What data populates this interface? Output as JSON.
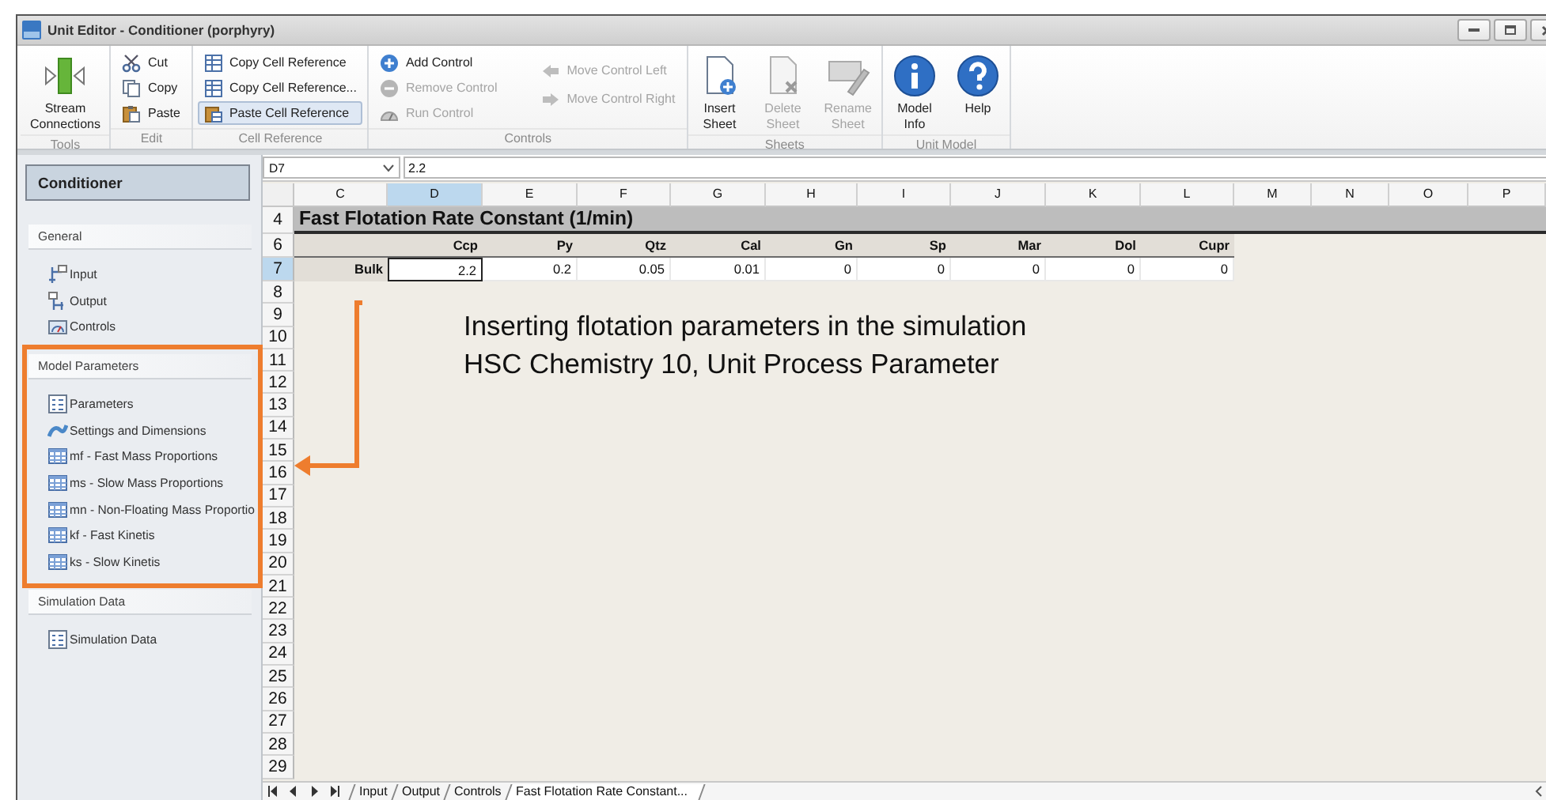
{
  "window": {
    "title": "Unit Editor - Conditioner (porphyry)"
  },
  "ribbon": {
    "groups": [
      {
        "label": "Tools",
        "columns": [
          [
            {
              "label": "Stream\nConnections",
              "kind": "large",
              "disabled": false,
              "highlighted": false
            }
          ]
        ]
      },
      {
        "label": "Edit",
        "columns": [
          [
            {
              "label": "Cut",
              "kind": "small",
              "disabled": false,
              "highlighted": false
            },
            {
              "label": "Copy",
              "kind": "small",
              "disabled": false,
              "highlighted": false
            },
            {
              "label": "Paste",
              "kind": "small",
              "disabled": false,
              "highlighted": false
            }
          ]
        ]
      },
      {
        "label": "Cell Reference",
        "columns": [
          [
            {
              "label": "Copy Cell Reference",
              "kind": "small",
              "disabled": false,
              "highlighted": false
            },
            {
              "label": "Copy Cell Reference...",
              "kind": "small",
              "disabled": false,
              "highlighted": false
            },
            {
              "label": "Paste Cell Reference",
              "kind": "small",
              "disabled": false,
              "highlighted": true
            }
          ]
        ]
      },
      {
        "label": "Controls",
        "columns": [
          [
            {
              "label": "Add Control",
              "kind": "small",
              "disabled": false,
              "highlighted": false
            },
            {
              "label": "Remove Control",
              "kind": "small",
              "disabled": true,
              "highlighted": false
            },
            {
              "label": "Run Control",
              "kind": "small",
              "disabled": true,
              "highlighted": false
            }
          ],
          [
            {
              "label": "Move Control Left",
              "kind": "small",
              "disabled": true,
              "highlighted": false
            },
            {
              "label": "Move Control Right",
              "kind": "small",
              "disabled": true,
              "highlighted": false
            }
          ]
        ]
      },
      {
        "label": "Sheets",
        "columns": [
          [
            {
              "label": "Insert\nSheet",
              "kind": "large",
              "disabled": false,
              "highlighted": false
            }
          ],
          [
            {
              "label": "Delete\nSheet",
              "kind": "large",
              "disabled": true,
              "highlighted": false
            }
          ],
          [
            {
              "label": "Rename\nSheet",
              "kind": "large",
              "disabled": true,
              "highlighted": false
            }
          ]
        ]
      },
      {
        "label": "Unit Model",
        "columns": [
          [
            {
              "label": "Model\nInfo",
              "kind": "large",
              "disabled": false,
              "highlighted": false
            }
          ],
          [
            {
              "label": "Help",
              "kind": "large",
              "disabled": false,
              "highlighted": false
            }
          ]
        ]
      }
    ]
  },
  "sidebar": {
    "header": "Conditioner",
    "sections": [
      {
        "title": "General",
        "items": [
          {
            "label": "Input"
          },
          {
            "label": "Output"
          },
          {
            "label": "Controls"
          }
        ]
      },
      {
        "title": "Model Parameters",
        "items": [
          {
            "label": "Parameters"
          },
          {
            "label": "Settings and Dimensions"
          },
          {
            "label": "mf - Fast Mass Proportions"
          },
          {
            "label": "ms - Slow Mass Proportions"
          },
          {
            "label": "mn - Non-Floating Mass Proportio"
          },
          {
            "label": "kf - Fast Kinetis"
          },
          {
            "label": "ks - Slow Kinetis"
          }
        ]
      },
      {
        "title": "Simulation Data",
        "items": [
          {
            "label": "Simulation Data"
          }
        ]
      }
    ]
  },
  "sheet": {
    "name_box": "D7",
    "formula": "2.2",
    "columns": [
      {
        "label": "C",
        "selected": false
      },
      {
        "label": "D",
        "selected": true
      },
      {
        "label": "E",
        "selected": false
      },
      {
        "label": "F",
        "selected": false
      },
      {
        "label": "G",
        "selected": false
      },
      {
        "label": "H",
        "selected": false
      },
      {
        "label": "I",
        "selected": false
      },
      {
        "label": "J",
        "selected": false
      },
      {
        "label": "K",
        "selected": false
      },
      {
        "label": "L",
        "selected": false
      },
      {
        "label": "M",
        "selected": false
      },
      {
        "label": "N",
        "selected": false
      },
      {
        "label": "O",
        "selected": false
      },
      {
        "label": "P",
        "selected": false
      }
    ],
    "rows": [
      {
        "label": "4",
        "selected": false,
        "kind": "title",
        "title": "Fast Flotation Rate Constant (1/min)"
      },
      {
        "label": "6",
        "selected": false,
        "kind": "headers",
        "cells": [
          "Ccp",
          "Py",
          "Qtz",
          "Cal",
          "Gn",
          "Sp",
          "Mar",
          "Dol",
          "Cupr"
        ]
      },
      {
        "label": "7",
        "selected": true,
        "kind": "values",
        "name": "Bulk",
        "cells": [
          {
            "value": "2.2",
            "selected": true
          },
          {
            "value": "0.2",
            "selected": false
          },
          {
            "value": "0.05",
            "selected": false
          },
          {
            "value": "0.01",
            "selected": false
          },
          {
            "value": "0",
            "selected": false
          },
          {
            "value": "0",
            "selected": false
          },
          {
            "value": "0",
            "selected": false
          },
          {
            "value": "0",
            "selected": false
          },
          {
            "value": "0",
            "selected": false
          }
        ]
      },
      {
        "label": "8",
        "selected": false,
        "kind": "empty"
      },
      {
        "label": "9",
        "selected": false,
        "kind": "empty"
      },
      {
        "label": "10",
        "selected": false,
        "kind": "empty"
      },
      {
        "label": "11",
        "selected": false,
        "kind": "empty"
      },
      {
        "label": "12",
        "selected": false,
        "kind": "empty"
      },
      {
        "label": "13",
        "selected": false,
        "kind": "empty"
      },
      {
        "label": "14",
        "selected": false,
        "kind": "empty"
      },
      {
        "label": "15",
        "selected": false,
        "kind": "empty"
      },
      {
        "label": "16",
        "selected": false,
        "kind": "empty"
      },
      {
        "label": "17",
        "selected": false,
        "kind": "empty"
      },
      {
        "label": "18",
        "selected": false,
        "kind": "empty"
      },
      {
        "label": "19",
        "selected": false,
        "kind": "empty"
      },
      {
        "label": "20",
        "selected": false,
        "kind": "empty"
      },
      {
        "label": "21",
        "selected": false,
        "kind": "empty"
      },
      {
        "label": "22",
        "selected": false,
        "kind": "empty"
      },
      {
        "label": "23",
        "selected": false,
        "kind": "empty"
      },
      {
        "label": "24",
        "selected": false,
        "kind": "empty"
      },
      {
        "label": "25",
        "selected": false,
        "kind": "empty"
      },
      {
        "label": "26",
        "selected": false,
        "kind": "empty"
      },
      {
        "label": "27",
        "selected": false,
        "kind": "empty"
      },
      {
        "label": "28",
        "selected": false,
        "kind": "empty"
      },
      {
        "label": "29",
        "selected": false,
        "kind": "empty"
      }
    ],
    "tabs": [
      {
        "label": "Input",
        "selected": false
      },
      {
        "label": "Output",
        "selected": false
      },
      {
        "label": "Controls",
        "selected": false
      },
      {
        "label": "Fast Flotation Rate Constant...",
        "selected": true
      }
    ]
  },
  "annotation": {
    "caption": "Inserting flotation parameters in the simulation\nHSC Chemistry 10, Unit Process Parameter"
  }
}
